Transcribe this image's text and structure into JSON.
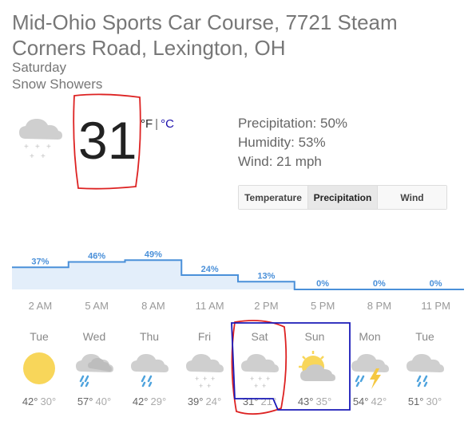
{
  "location": {
    "line1": "Mid-Ohio Sports Car Course, 7721 Steam",
    "line2": "Corners Road, Lexington, OH"
  },
  "current": {
    "day": "Saturday",
    "condition": "Snow Showers",
    "icon": "snow-cloud-icon",
    "temperature": "31",
    "unit_f": "°F",
    "unit_sep": "|",
    "unit_c": "°C",
    "precipitation": "Precipitation: 50%",
    "humidity": "Humidity: 53%",
    "wind": "Wind: 21 mph"
  },
  "tabs": [
    {
      "label": "Temperature",
      "active": false
    },
    {
      "label": "Precipitation",
      "active": true
    },
    {
      "label": "Wind",
      "active": false
    }
  ],
  "chart_data": {
    "type": "area",
    "x": [
      "2 AM",
      "5 AM",
      "8 AM",
      "11 AM",
      "2 PM",
      "5 PM",
      "8 PM",
      "11 PM"
    ],
    "series": [
      {
        "values": [
          37,
          46,
          49,
          24,
          13,
          0,
          0,
          0
        ]
      }
    ],
    "labels": [
      "37%",
      "46%",
      "49%",
      "24%",
      "13%",
      "0%",
      "0%",
      "0%"
    ],
    "color": "#4a90d9",
    "fill": "#e3eefa"
  },
  "forecast": [
    {
      "day": "Tue",
      "icon": "sun-icon",
      "hi": "42°",
      "lo": "30°"
    },
    {
      "day": "Wed",
      "icon": "rain-cloud-icon",
      "hi": "57°",
      "lo": "40°"
    },
    {
      "day": "Thu",
      "icon": "rain-cloud-icon",
      "hi": "42°",
      "lo": "29°"
    },
    {
      "day": "Fri",
      "icon": "snow-cloud-icon",
      "hi": "39°",
      "lo": "24°"
    },
    {
      "day": "Sat",
      "icon": "snow-cloud-icon",
      "hi": "31°",
      "lo": "21°"
    },
    {
      "day": "Sun",
      "icon": "partly-sunny-icon",
      "hi": "43°",
      "lo": "35°"
    },
    {
      "day": "Mon",
      "icon": "thunderstorm-icon",
      "hi": "54°",
      "lo": "42°"
    },
    {
      "day": "Tue",
      "icon": "rain-cloud-icon",
      "hi": "51°",
      "lo": "30°"
    }
  ]
}
